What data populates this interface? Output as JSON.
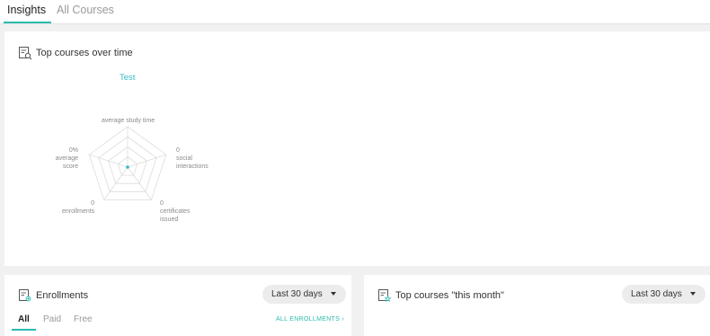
{
  "tabs": [
    {
      "label": "Insights",
      "active": true
    },
    {
      "label": "All Courses",
      "active": false
    }
  ],
  "top_courses": {
    "title": "Top courses over time",
    "series_name": "Test",
    "radar_color": "#3ab8c8",
    "axes": [
      {
        "value": "",
        "label": "average study time"
      },
      {
        "value": "0",
        "label": "social interactions"
      },
      {
        "value": "0",
        "label": "certificates issued"
      },
      {
        "value": "0",
        "label": "enrollments"
      },
      {
        "value": "0%",
        "label": "average score"
      }
    ]
  },
  "enrollments": {
    "title": "Enrollments",
    "period": "Last 30 days",
    "subtabs": [
      "All",
      "Paid",
      "Free"
    ],
    "link": "ALL ENROLLMENTS"
  },
  "top_courses_month": {
    "title": "Top courses \"this month\"",
    "period": "Last 30 days"
  },
  "colors": {
    "accent": "#2bbbad",
    "background": "#f1f1f1"
  }
}
